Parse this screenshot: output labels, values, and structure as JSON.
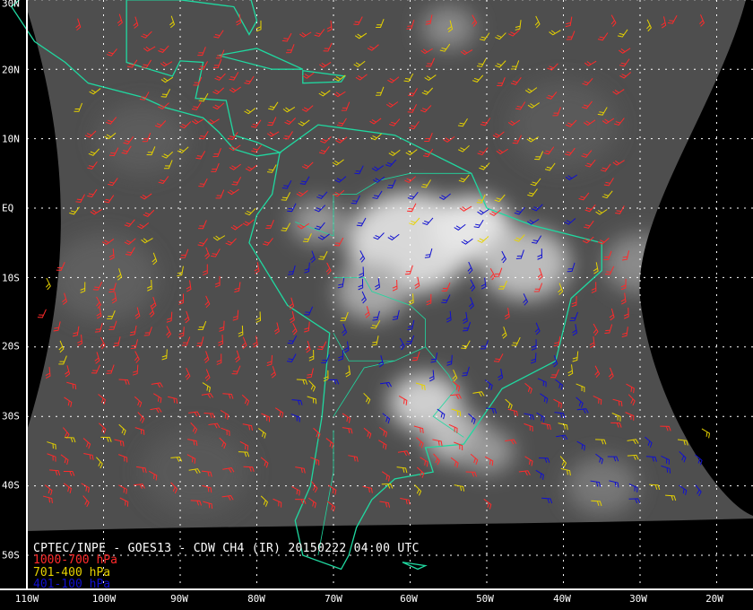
{
  "title": "CPTEC/INPE - GOES13 - CDW CH4 (IR) 20150222 04:00 UTC",
  "legend": [
    {
      "label": "1000-700 hPa",
      "color": "#ff2a2a"
    },
    {
      "label": "701-400 hPa",
      "color": "#e6d200"
    },
    {
      "label": "401-100 hPa",
      "color": "#1010d0"
    }
  ],
  "longitude_labels": [
    "110W",
    "100W",
    "90W",
    "80W",
    "70W",
    "60W",
    "50W",
    "40W",
    "30W",
    "20W"
  ],
  "latitude_labels": [
    "30N",
    "20N",
    "10N",
    "EQ",
    "10S",
    "20S",
    "30S",
    "40S",
    "50S"
  ],
  "colors": {
    "coastline": "#20d8a0",
    "grid": "#ffffff",
    "background": "#000000"
  }
}
